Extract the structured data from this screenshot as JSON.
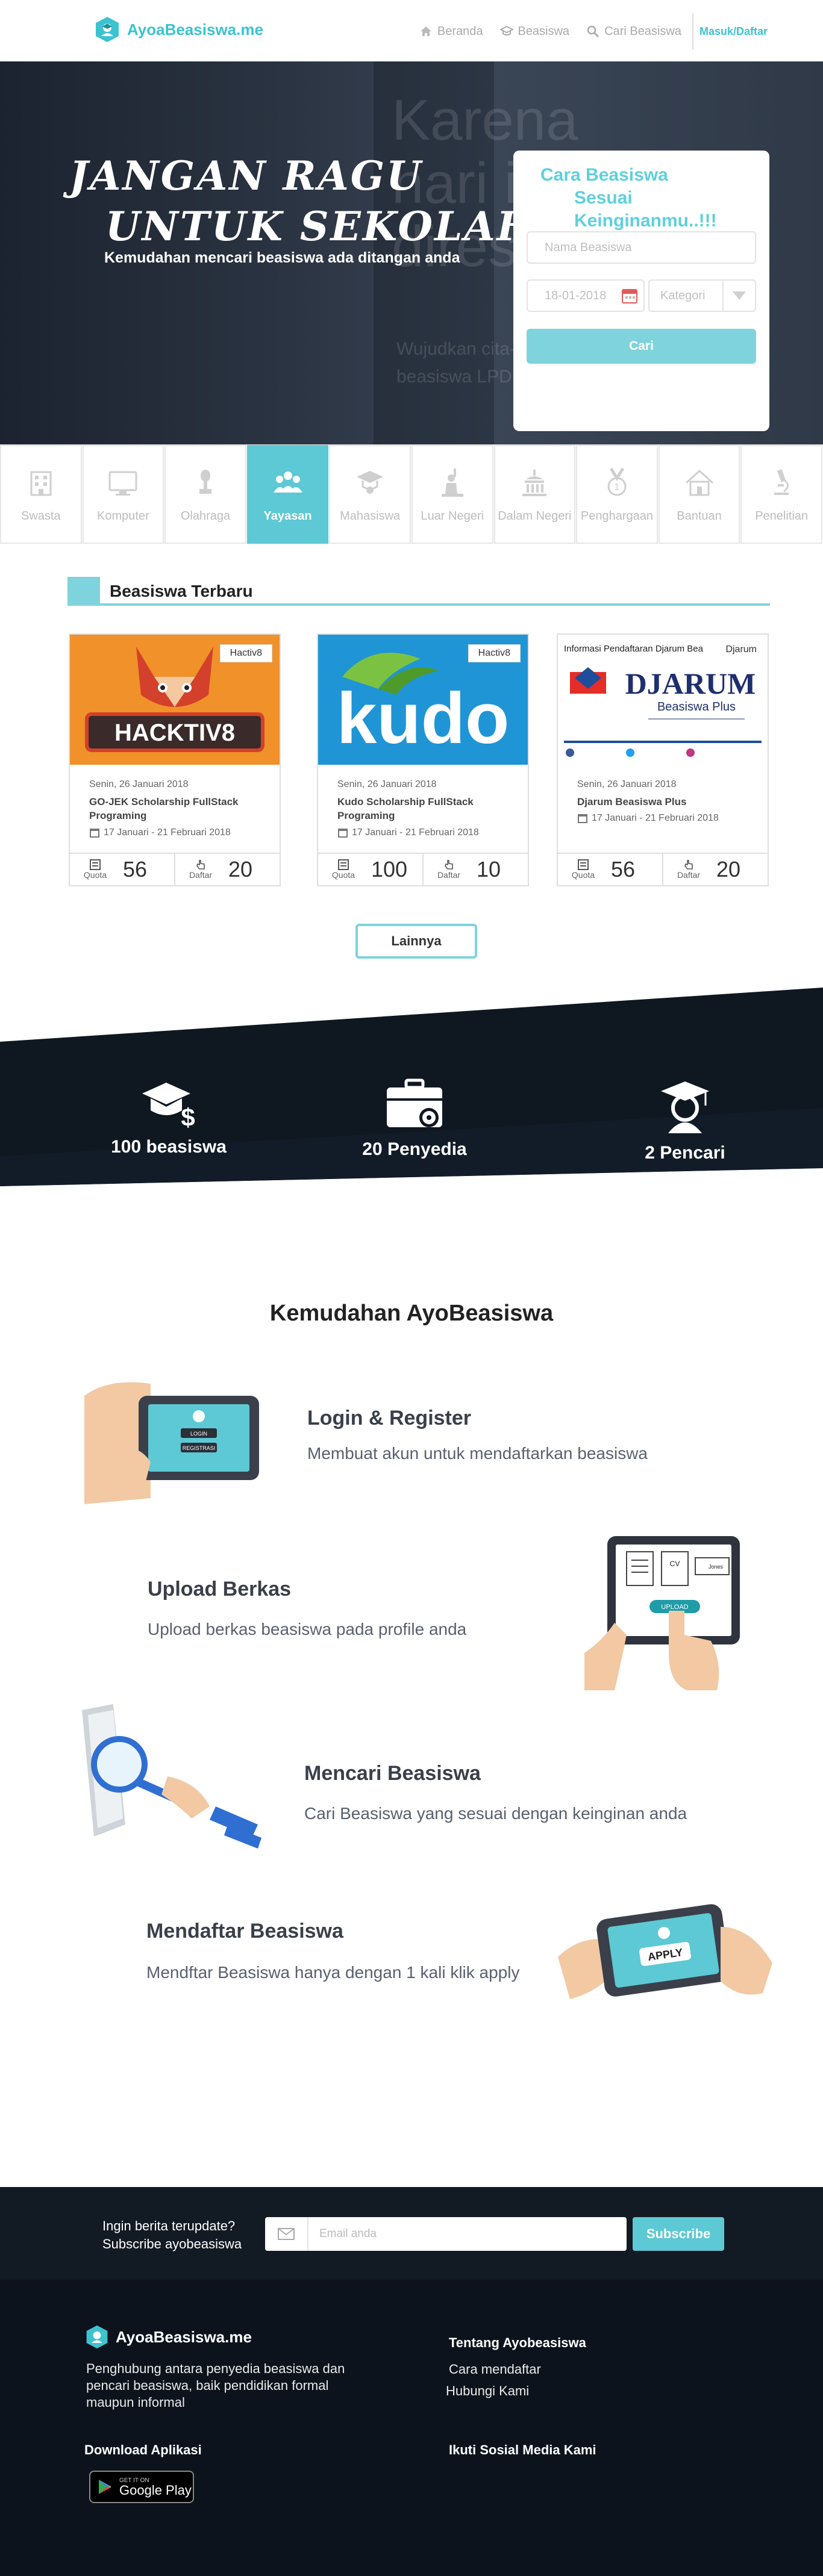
{
  "brand": {
    "name": "AyoaBeasiswa.me"
  },
  "nav": {
    "items": [
      {
        "label": "Beranda",
        "icon": "home-icon"
      },
      {
        "label": "Beasiswa",
        "icon": "graduation-cap-icon"
      },
      {
        "label": "Cari Beasiswa",
        "icon": "search-icon"
      }
    ],
    "login_label": "Masuk/Daftar"
  },
  "hero": {
    "title_line1": "JANGAN RAGU",
    "title_line2": "UNTUK SEKOLAH !",
    "subtitle": "Kemudahan mencari beasiswa ada ditangan anda",
    "background_ghost_lines": [
      "Karena",
      "hari ini",
      "direspon"
    ],
    "background_ghost_small": [
      "Wujudkan cita-ci",
      "beasiswa LPDP."
    ]
  },
  "search": {
    "title_line1": "Cara Beasiswa",
    "title_line2": "Sesuai Keinginanmu..!!!",
    "name_placeholder": "Nama Beasiswa",
    "date_value": "18-01-2018",
    "category_placeholder": "Kategori",
    "submit_label": "Cari"
  },
  "categories": [
    {
      "label": "Swasta",
      "icon": "building-icon",
      "active": false
    },
    {
      "label": "Komputer",
      "icon": "monitor-icon",
      "active": false
    },
    {
      "label": "Olahraga",
      "icon": "trophy-icon",
      "active": false
    },
    {
      "label": "Yayasan",
      "icon": "people-group-icon",
      "active": true
    },
    {
      "label": "Mahasiswa",
      "icon": "student-icon",
      "active": false
    },
    {
      "label": "Luar Negeri",
      "icon": "statue-of-liberty-icon",
      "active": false
    },
    {
      "label": "Dalam Negeri",
      "icon": "monument-icon",
      "active": false
    },
    {
      "label": "Penghargaan",
      "icon": "medal-icon",
      "active": false
    },
    {
      "label": "Bantuan",
      "icon": "house-icon",
      "active": false
    },
    {
      "label": "Penelitian",
      "icon": "microscope-icon",
      "active": false
    }
  ],
  "latest": {
    "section_title": "Beasiswa Terbaru",
    "more_label": "Lainnya",
    "quota_label": "Quota",
    "applied_label": "Daftar",
    "cards": [
      {
        "tag": "Hactiv8",
        "image_text": "HACKTIV8",
        "date": "Senin, 26 Januari 2018",
        "title": "GO-JEK Scholarship FullStack Programing",
        "range": "17 Januari - 21 Februari 2018",
        "quota": "56",
        "applied": "20"
      },
      {
        "tag": "Hactiv8",
        "image_text": "kudo",
        "date": "Senin, 26 Januari 2018",
        "title": "Kudo Scholarship FullStack Programing",
        "range": "17 Januari - 21 Februari 2018",
        "quota": "100",
        "applied": "10"
      },
      {
        "tag": "Djarum",
        "image_text": "DJARUM",
        "image_sub": "Beasiswa Plus",
        "image_header": "Informasi Pendaftaran Djarum Bea",
        "date": "Senin, 26 Januari 2018",
        "title": "Djarum Beasiswa Plus",
        "range": "17 Januari - 21 Februari 2018",
        "quota": "56",
        "applied": "20"
      }
    ]
  },
  "stats": [
    {
      "label": "100 beasiswa",
      "icon": "cap-dollar-icon"
    },
    {
      "label": "20 Penyedia",
      "icon": "briefcase-gear-icon"
    },
    {
      "label": "2 Pencari",
      "icon": "user-graduate-icon"
    }
  ],
  "features": {
    "heading": "Kemudahan AyoBeasiswa",
    "items": [
      {
        "title": "Login & Register",
        "desc": "Membuat akun untuk mendaftarkan beasiswa",
        "screen_buttons": [
          "LOGIN",
          "REGISTRASI"
        ]
      },
      {
        "title": "Upload Berkas",
        "desc": "Upload berkas beasiswa pada profile anda",
        "screen_labels": [
          "CV",
          "Jones"
        ],
        "screen_button": "UPLOAD"
      },
      {
        "title": "Mencari Beasiswa",
        "desc": "Cari Beasiswa yang sesuai dengan keinginan anda"
      },
      {
        "title": "Mendaftar Beasiswa",
        "desc": "Mendftar Beasiswa hanya dengan 1 kali klik apply",
        "screen_button": "APPLY"
      }
    ]
  },
  "newsletter": {
    "text_line1": "Ingin berita terupdate?",
    "text_line2": "Subscribe ayobeasiswa",
    "placeholder": "Email anda",
    "button_label": "Subscribe"
  },
  "footer": {
    "brand": "AyoaBeasiswa.me",
    "description": "Penghubung antara penyedia beasiswa dan pencari beasiswa, baik pendidikan formal maupun informal",
    "about_heading": "Tentang Ayobeasiswa",
    "links": [
      "Cara mendaftar",
      "Hubungi Kami"
    ],
    "download_heading": "Download Aplikasi",
    "social_heading": "Ikuti Sosial Media Kami",
    "store_small": "GET IT ON",
    "store_big": "Google Play"
  },
  "colors": {
    "accent": "#5cc9d4",
    "accent_light": "#7fd3dc",
    "dark": "#0c131c"
  }
}
